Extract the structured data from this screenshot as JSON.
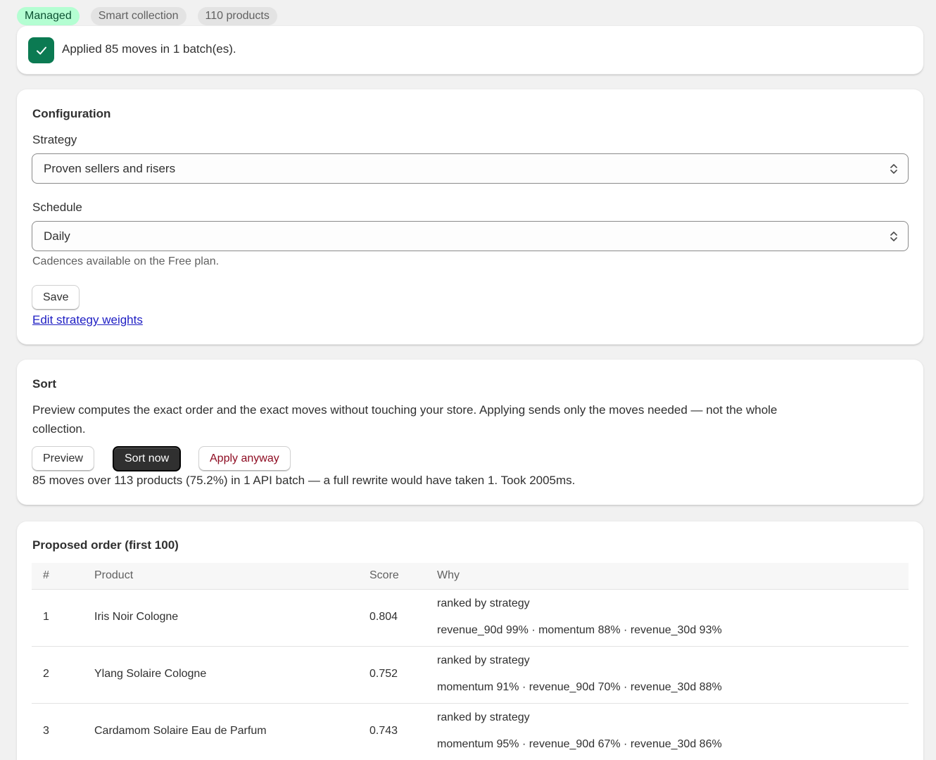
{
  "badges": {
    "managed": "Managed",
    "collection_type": "Smart collection",
    "product_count": "110 products"
  },
  "banner": {
    "message": "Applied 85 moves in 1 batch(es)."
  },
  "config": {
    "heading": "Configuration",
    "strategy_label": "Strategy",
    "strategy_value": "Proven sellers and risers",
    "schedule_label": "Schedule",
    "schedule_value": "Daily",
    "schedule_help": "Cadences available on the Free plan.",
    "save_label": "Save",
    "edit_weights_link": "Edit strategy weights"
  },
  "sort": {
    "heading": "Sort",
    "description": "Preview computes the exact order and the exact moves without touching your store. Applying sends only the moves needed — not the whole collection.",
    "preview_label": "Preview",
    "sort_now_label": "Sort now",
    "apply_anyway_label": "Apply anyway",
    "result": "85 moves over 113 products (75.2%) in 1 API batch — a full rewrite would have taken 1. Took 2005ms."
  },
  "proposed": {
    "heading": "Proposed order (first 100)",
    "columns": {
      "rank": "#",
      "product": "Product",
      "score": "Score",
      "why": "Why"
    },
    "rows": [
      {
        "rank": "1",
        "product": "Iris Noir Cologne",
        "score": "0.804",
        "reason": "ranked by strategy",
        "factors": "revenue_90d 99% · momentum 88% · revenue_30d 93%"
      },
      {
        "rank": "2",
        "product": "Ylang Solaire Cologne",
        "score": "0.752",
        "reason": "ranked by strategy",
        "factors": "momentum 91% · revenue_90d 70% · revenue_30d 88%"
      },
      {
        "rank": "3",
        "product": "Cardamom Solaire Eau de Parfum",
        "score": "0.743",
        "reason": "ranked by strategy",
        "factors": "momentum 95% · revenue_90d 67% · revenue_30d 86%"
      }
    ]
  }
}
